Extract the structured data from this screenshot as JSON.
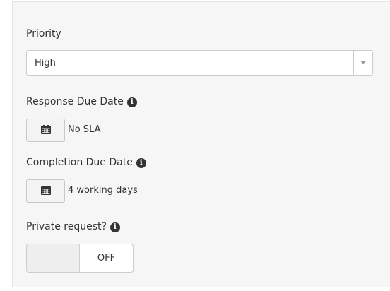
{
  "priority": {
    "label": "Priority",
    "selected": "High"
  },
  "response_due": {
    "label": "Response Due Date",
    "info_icon": "info-circle-icon",
    "calendar_icon": "calendar-icon",
    "value": "No SLA"
  },
  "completion_due": {
    "label": "Completion Due Date",
    "info_icon": "info-circle-icon",
    "calendar_icon": "calendar-icon",
    "value": "4 working days"
  },
  "private_request": {
    "label": "Private request?",
    "info_icon": "info-circle-icon",
    "toggle_state": "OFF"
  },
  "colors": {
    "panel_bg": "#f6f6f6",
    "border": "#cccccc",
    "text": "#333333"
  }
}
